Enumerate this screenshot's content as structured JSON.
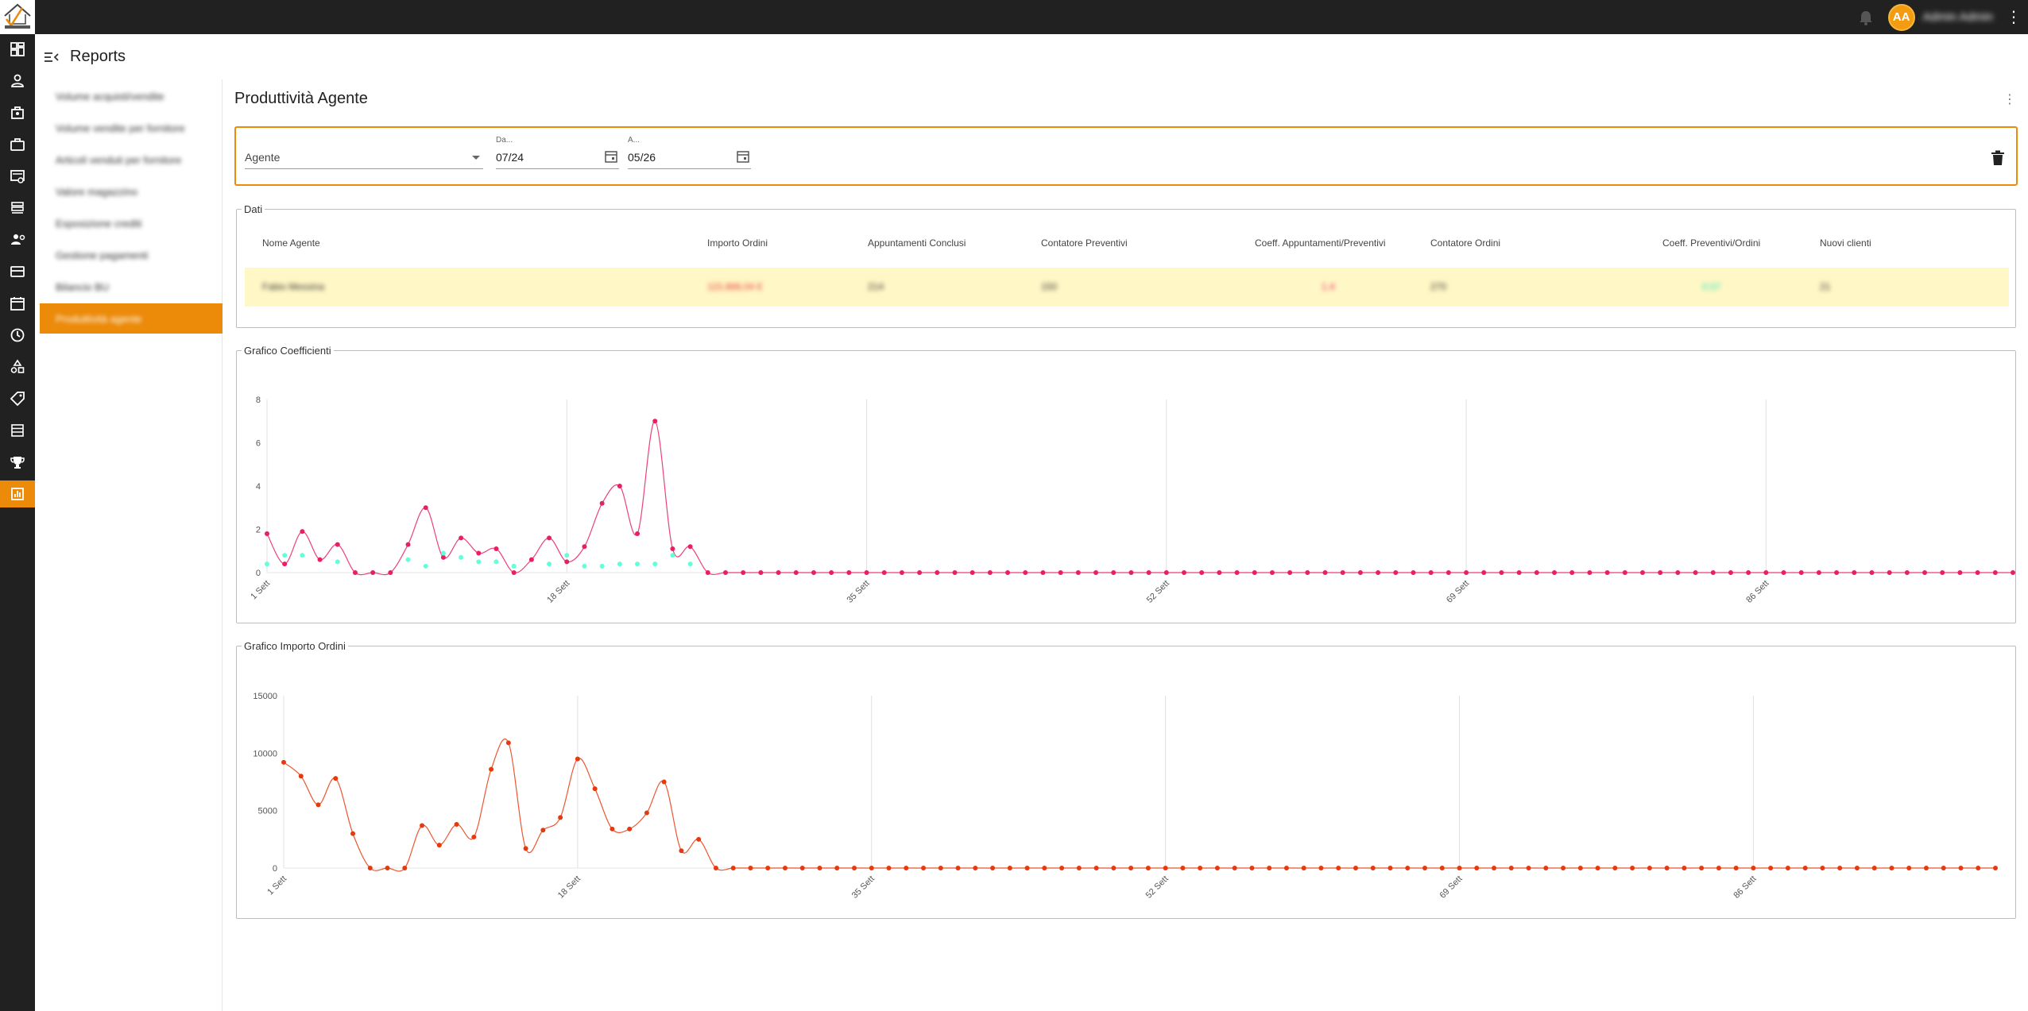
{
  "app": {
    "user_initials": "AA",
    "user_name": "Admin Admin",
    "colors": {
      "accent": "#ec8a09",
      "topbar": "#212121",
      "row_highlight": "#fff7c6"
    }
  },
  "header": {
    "title": "Reports"
  },
  "rail_icons": [
    "dashboard-icon",
    "person-icon",
    "store-icon",
    "briefcase-icon",
    "invoice-icon",
    "swap-icon",
    "person-gear-icon",
    "card-icon",
    "calendar-icon",
    "clock-icon",
    "shapes-icon",
    "tag-icon",
    "list-icon",
    "trophy-icon",
    "report-icon"
  ],
  "sidebar": {
    "items": [
      {
        "label": "Volume acquisti/vendite"
      },
      {
        "label": "Volume vendite per fornitore"
      },
      {
        "label": "Articoli venduti per fornitore"
      },
      {
        "label": "Valore magazzino"
      },
      {
        "label": "Esposizione crediti"
      },
      {
        "label": "Gestione pagamenti"
      },
      {
        "label": "Bilancio BU"
      },
      {
        "label": "Produttività agente"
      }
    ]
  },
  "main": {
    "title": "Produttività Agente",
    "filters": {
      "agent_placeholder": "Agente",
      "from_label": "Da...",
      "from_value": "07/24",
      "to_label": "A...",
      "to_value": "05/26"
    },
    "table": {
      "legend": "Dati",
      "columns": [
        "Nome Agente",
        "Importo Ordini",
        "Appuntamenti Conclusi",
        "Contatore Preventivi",
        "Coeff. Appuntamenti/Preventivi",
        "Contatore Ordini",
        "Coeff. Preventivi/Ordini",
        "Nuovi clienti"
      ],
      "row": [
        "Fabio Messina",
        "115.888,04 €",
        "214",
        "150",
        "1.4",
        "270",
        "0.57",
        "21"
      ]
    }
  },
  "chart_data": [
    {
      "type": "line",
      "title": "Grafico Coefficienti",
      "ylim": [
        0,
        8
      ],
      "y_ticks": [
        "0",
        "2",
        "4",
        "6",
        "8"
      ],
      "x_tick_labels": [
        "1 Sett",
        "18 Sett",
        "35 Sett",
        "52 Sett",
        "69 Sett",
        "86 Sett"
      ],
      "x_tick_indices": [
        0,
        17,
        34,
        51,
        68,
        85
      ],
      "point_count": 100,
      "series": [
        {
          "color": "#e91e63",
          "values": [
            1.8,
            0.4,
            1.9,
            0.6,
            1.3,
            0,
            0,
            0,
            1.3,
            3.0,
            0.7,
            1.6,
            0.9,
            1.1,
            0,
            0.6,
            1.6,
            0.5,
            1.2,
            3.2,
            4.0,
            1.8,
            7.0,
            1.1,
            1.2,
            0,
            0,
            0,
            0,
            0,
            0,
            0,
            0,
            0,
            0,
            0,
            0,
            0,
            0,
            0,
            0,
            0,
            0,
            0,
            0,
            0,
            0,
            0,
            0,
            0,
            0,
            0,
            0,
            0,
            0,
            0,
            0,
            0,
            0,
            0,
            0,
            0,
            0,
            0,
            0,
            0,
            0,
            0,
            0,
            0,
            0,
            0,
            0,
            0,
            0,
            0,
            0,
            0,
            0,
            0,
            0,
            0,
            0,
            0,
            0,
            0,
            0,
            0,
            0,
            0,
            0,
            0,
            0,
            0,
            0,
            0,
            0,
            0,
            0,
            0
          ]
        },
        {
          "color": "#64ffda",
          "values": [
            0.4,
            0.8,
            0.8,
            null,
            0.5,
            null,
            null,
            null,
            0.6,
            0.3,
            0.9,
            0.7,
            0.5,
            0.5,
            0.3,
            null,
            0.4,
            0.8,
            0.3,
            0.3,
            0.4,
            0.4,
            0.4,
            0.8,
            0.4
          ]
        }
      ]
    },
    {
      "type": "line",
      "title": "Grafico Importo Ordini",
      "ylim": [
        0,
        15000
      ],
      "y_ticks": [
        "0",
        "5000",
        "10000",
        "15000"
      ],
      "x_tick_labels": [
        "1 Sett",
        "18 Sett",
        "35 Sett",
        "52 Sett",
        "69 Sett",
        "86 Sett"
      ],
      "x_tick_indices": [
        0,
        17,
        34,
        51,
        68,
        85
      ],
      "point_count": 100,
      "series": [
        {
          "color": "#e8380d",
          "values": [
            9200,
            8000,
            5500,
            7800,
            3000,
            0,
            0,
            0,
            3700,
            2000,
            3800,
            2700,
            8600,
            10900,
            1700,
            3300,
            4400,
            9500,
            6900,
            3400,
            3400,
            4800,
            7500,
            1500,
            2500,
            0,
            0,
            0,
            0,
            0,
            0,
            0,
            0,
            0,
            0,
            0,
            0,
            0,
            0,
            0,
            0,
            0,
            0,
            0,
            0,
            0,
            0,
            0,
            0,
            0,
            0,
            0,
            0,
            0,
            0,
            0,
            0,
            0,
            0,
            0,
            0,
            0,
            0,
            0,
            0,
            0,
            0,
            0,
            0,
            0,
            0,
            0,
            0,
            0,
            0,
            0,
            0,
            0,
            0,
            0,
            0,
            0,
            0,
            0,
            0,
            0,
            0,
            0,
            0,
            0,
            0,
            0,
            0,
            0,
            0,
            0,
            0,
            0,
            0,
            0
          ]
        }
      ]
    }
  ]
}
